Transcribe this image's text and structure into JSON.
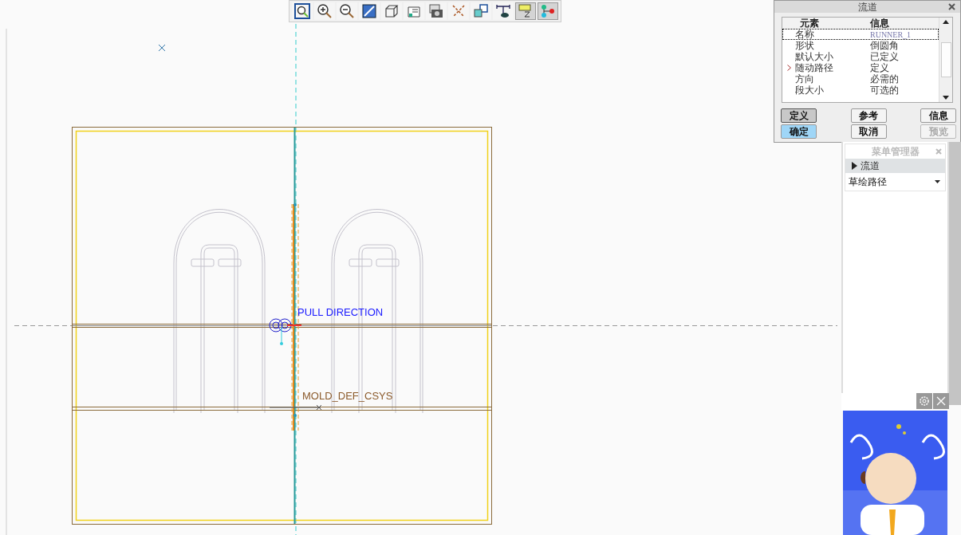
{
  "toolbar": [
    {
      "kind": "zoom-fit",
      "pressed": false
    },
    {
      "kind": "zoom-in",
      "pressed": false
    },
    {
      "kind": "zoom-out",
      "pressed": false
    },
    {
      "kind": "repaint",
      "pressed": false
    },
    {
      "kind": "view-cube",
      "pressed": false
    },
    {
      "kind": "saved-views",
      "pressed": false
    },
    {
      "kind": "camera",
      "pressed": false
    },
    {
      "kind": "datum-display",
      "pressed": false
    },
    {
      "kind": "spin",
      "pressed": false
    },
    {
      "kind": "dimension",
      "pressed": false
    },
    {
      "kind": "annotation",
      "pressed": true
    },
    {
      "kind": "nodes",
      "pressed": true
    }
  ],
  "canvas": {
    "labels": [
      {
        "kind": "pull",
        "text": "PULL DIRECTION"
      },
      {
        "kind": "csys",
        "text": "MOLD_DEF_CSYS"
      }
    ]
  },
  "dialog": {
    "title": "流道",
    "columns": [
      "元素",
      "信息"
    ],
    "rows": [
      {
        "element": "名称",
        "info": "RUNNER_1",
        "selected": true,
        "current": false
      },
      {
        "element": "形状",
        "info": "倒圆角",
        "selected": false,
        "current": false
      },
      {
        "element": "默认大小",
        "info": "已定义",
        "selected": false,
        "current": false
      },
      {
        "element": "随动路径",
        "info": "定义",
        "selected": false,
        "current": true
      },
      {
        "element": "方向",
        "info": "必需的",
        "selected": false,
        "current": false
      },
      {
        "element": "段大小",
        "info": "可选的",
        "selected": false,
        "current": false
      }
    ],
    "buttons": [
      {
        "label": "定义",
        "pressed": true,
        "default": false,
        "disabled": false
      },
      {
        "label": "参考",
        "pressed": false,
        "default": false,
        "disabled": false
      },
      {
        "label": "信息",
        "pressed": false,
        "default": false,
        "disabled": false
      },
      {
        "label": "确定",
        "pressed": false,
        "default": true,
        "disabled": false
      },
      {
        "label": "取消",
        "pressed": false,
        "default": false,
        "disabled": false
      },
      {
        "label": "预览",
        "pressed": false,
        "default": false,
        "disabled": true
      }
    ]
  },
  "menu_manager": {
    "title": "菜单管理器",
    "header": {
      "label": "流道",
      "expanded": true
    },
    "items": [
      {
        "label": "草绘路径"
      }
    ]
  }
}
